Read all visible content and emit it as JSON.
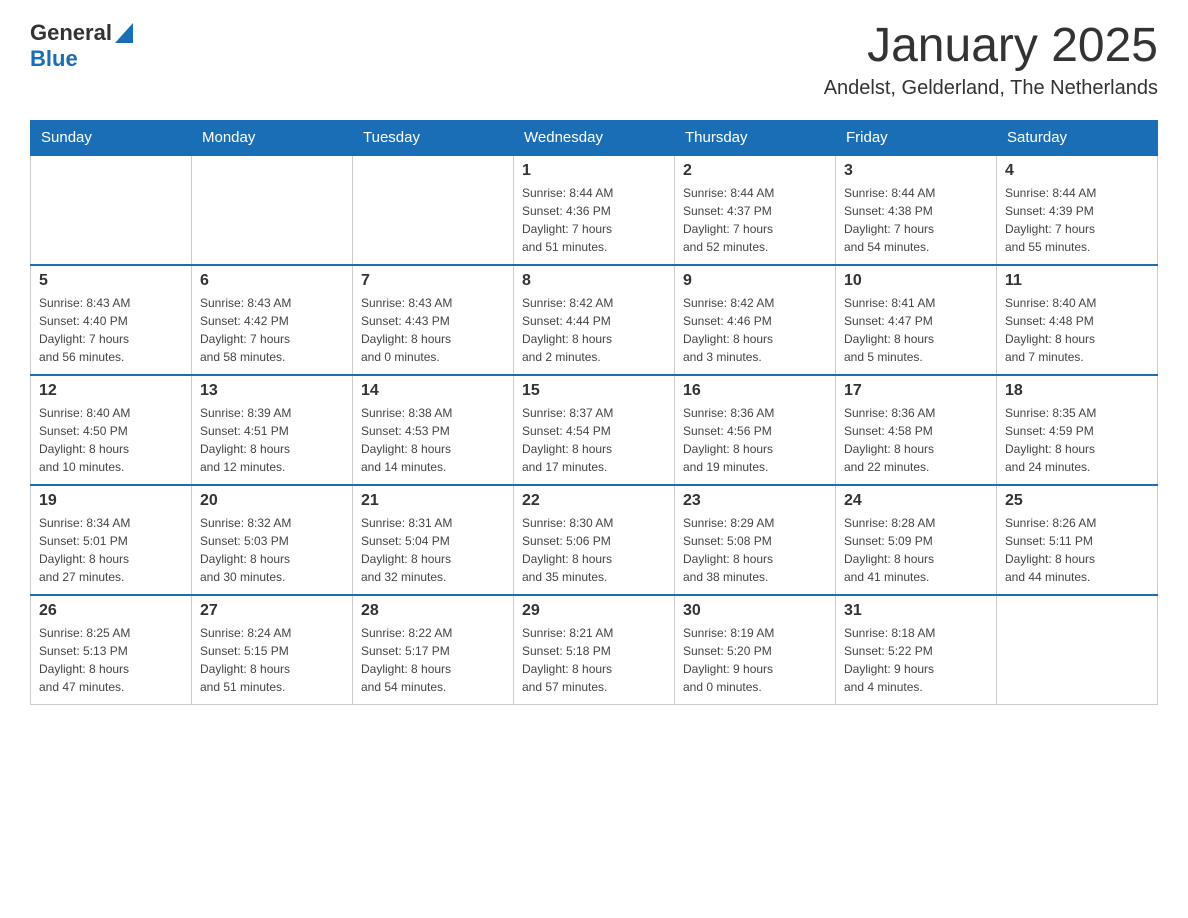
{
  "header": {
    "logo_general": "General",
    "logo_blue": "Blue",
    "title": "January 2025",
    "subtitle": "Andelst, Gelderland, The Netherlands"
  },
  "days_of_week": [
    "Sunday",
    "Monday",
    "Tuesday",
    "Wednesday",
    "Thursday",
    "Friday",
    "Saturday"
  ],
  "weeks": [
    [
      {
        "day": "",
        "info": ""
      },
      {
        "day": "",
        "info": ""
      },
      {
        "day": "",
        "info": ""
      },
      {
        "day": "1",
        "info": "Sunrise: 8:44 AM\nSunset: 4:36 PM\nDaylight: 7 hours\nand 51 minutes."
      },
      {
        "day": "2",
        "info": "Sunrise: 8:44 AM\nSunset: 4:37 PM\nDaylight: 7 hours\nand 52 minutes."
      },
      {
        "day": "3",
        "info": "Sunrise: 8:44 AM\nSunset: 4:38 PM\nDaylight: 7 hours\nand 54 minutes."
      },
      {
        "day": "4",
        "info": "Sunrise: 8:44 AM\nSunset: 4:39 PM\nDaylight: 7 hours\nand 55 minutes."
      }
    ],
    [
      {
        "day": "5",
        "info": "Sunrise: 8:43 AM\nSunset: 4:40 PM\nDaylight: 7 hours\nand 56 minutes."
      },
      {
        "day": "6",
        "info": "Sunrise: 8:43 AM\nSunset: 4:42 PM\nDaylight: 7 hours\nand 58 minutes."
      },
      {
        "day": "7",
        "info": "Sunrise: 8:43 AM\nSunset: 4:43 PM\nDaylight: 8 hours\nand 0 minutes."
      },
      {
        "day": "8",
        "info": "Sunrise: 8:42 AM\nSunset: 4:44 PM\nDaylight: 8 hours\nand 2 minutes."
      },
      {
        "day": "9",
        "info": "Sunrise: 8:42 AM\nSunset: 4:46 PM\nDaylight: 8 hours\nand 3 minutes."
      },
      {
        "day": "10",
        "info": "Sunrise: 8:41 AM\nSunset: 4:47 PM\nDaylight: 8 hours\nand 5 minutes."
      },
      {
        "day": "11",
        "info": "Sunrise: 8:40 AM\nSunset: 4:48 PM\nDaylight: 8 hours\nand 7 minutes."
      }
    ],
    [
      {
        "day": "12",
        "info": "Sunrise: 8:40 AM\nSunset: 4:50 PM\nDaylight: 8 hours\nand 10 minutes."
      },
      {
        "day": "13",
        "info": "Sunrise: 8:39 AM\nSunset: 4:51 PM\nDaylight: 8 hours\nand 12 minutes."
      },
      {
        "day": "14",
        "info": "Sunrise: 8:38 AM\nSunset: 4:53 PM\nDaylight: 8 hours\nand 14 minutes."
      },
      {
        "day": "15",
        "info": "Sunrise: 8:37 AM\nSunset: 4:54 PM\nDaylight: 8 hours\nand 17 minutes."
      },
      {
        "day": "16",
        "info": "Sunrise: 8:36 AM\nSunset: 4:56 PM\nDaylight: 8 hours\nand 19 minutes."
      },
      {
        "day": "17",
        "info": "Sunrise: 8:36 AM\nSunset: 4:58 PM\nDaylight: 8 hours\nand 22 minutes."
      },
      {
        "day": "18",
        "info": "Sunrise: 8:35 AM\nSunset: 4:59 PM\nDaylight: 8 hours\nand 24 minutes."
      }
    ],
    [
      {
        "day": "19",
        "info": "Sunrise: 8:34 AM\nSunset: 5:01 PM\nDaylight: 8 hours\nand 27 minutes."
      },
      {
        "day": "20",
        "info": "Sunrise: 8:32 AM\nSunset: 5:03 PM\nDaylight: 8 hours\nand 30 minutes."
      },
      {
        "day": "21",
        "info": "Sunrise: 8:31 AM\nSunset: 5:04 PM\nDaylight: 8 hours\nand 32 minutes."
      },
      {
        "day": "22",
        "info": "Sunrise: 8:30 AM\nSunset: 5:06 PM\nDaylight: 8 hours\nand 35 minutes."
      },
      {
        "day": "23",
        "info": "Sunrise: 8:29 AM\nSunset: 5:08 PM\nDaylight: 8 hours\nand 38 minutes."
      },
      {
        "day": "24",
        "info": "Sunrise: 8:28 AM\nSunset: 5:09 PM\nDaylight: 8 hours\nand 41 minutes."
      },
      {
        "day": "25",
        "info": "Sunrise: 8:26 AM\nSunset: 5:11 PM\nDaylight: 8 hours\nand 44 minutes."
      }
    ],
    [
      {
        "day": "26",
        "info": "Sunrise: 8:25 AM\nSunset: 5:13 PM\nDaylight: 8 hours\nand 47 minutes."
      },
      {
        "day": "27",
        "info": "Sunrise: 8:24 AM\nSunset: 5:15 PM\nDaylight: 8 hours\nand 51 minutes."
      },
      {
        "day": "28",
        "info": "Sunrise: 8:22 AM\nSunset: 5:17 PM\nDaylight: 8 hours\nand 54 minutes."
      },
      {
        "day": "29",
        "info": "Sunrise: 8:21 AM\nSunset: 5:18 PM\nDaylight: 8 hours\nand 57 minutes."
      },
      {
        "day": "30",
        "info": "Sunrise: 8:19 AM\nSunset: 5:20 PM\nDaylight: 9 hours\nand 0 minutes."
      },
      {
        "day": "31",
        "info": "Sunrise: 8:18 AM\nSunset: 5:22 PM\nDaylight: 9 hours\nand 4 minutes."
      },
      {
        "day": "",
        "info": ""
      }
    ]
  ]
}
